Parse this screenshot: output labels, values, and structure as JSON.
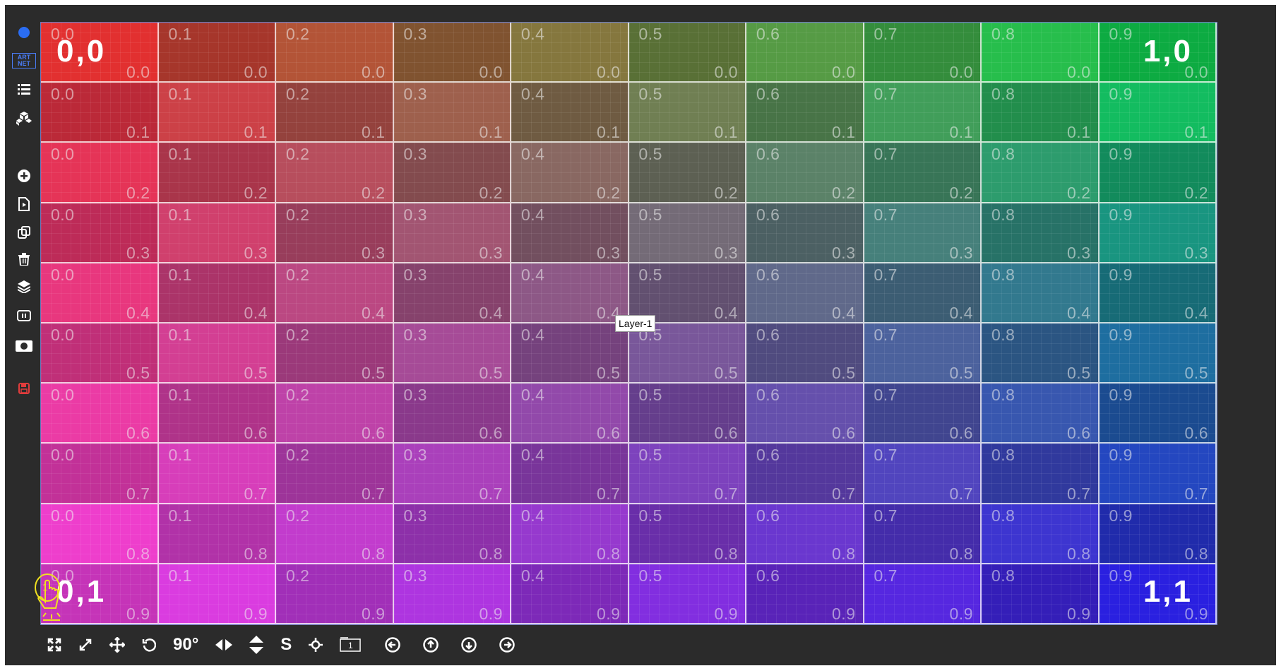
{
  "sidebar": {
    "items": [
      {
        "name": "status-dot-icon",
        "color": "#2a6df4"
      },
      {
        "name": "artnet-icon",
        "label": "ART NET"
      },
      {
        "name": "list-icon"
      },
      {
        "name": "cubes-icon"
      },
      {
        "name": "add-icon"
      },
      {
        "name": "file-play-icon"
      },
      {
        "name": "copy-icon"
      },
      {
        "name": "trash-icon"
      },
      {
        "name": "layers-icon"
      },
      {
        "name": "pause-icon"
      },
      {
        "name": "mask-icon"
      },
      {
        "name": "save-icon",
        "color": "#e23c3c"
      }
    ]
  },
  "canvas": {
    "columns": [
      "0.0",
      "0.1",
      "0.2",
      "0.3",
      "0.4",
      "0.5",
      "0.6",
      "0.7",
      "0.8",
      "0.9"
    ],
    "rows": [
      "0.0",
      "0.1",
      "0.2",
      "0.3",
      "0.4",
      "0.5",
      "0.6",
      "0.7",
      "0.8",
      "0.9"
    ],
    "corner_colors": {
      "top_left": "#e23030",
      "top_right": "#10d050",
      "bottom_left": "#f040e0",
      "bottom_right": "#2a20e0"
    },
    "corners": {
      "top_left": "0,0",
      "top_right": "1,0",
      "bottom_left": "0,1",
      "bottom_right": "1,1"
    },
    "layer_label": "Layer-1"
  },
  "cursor": {
    "badge": "1"
  },
  "toolbar": {
    "items": [
      {
        "name": "fullscreen-icon"
      },
      {
        "name": "resize-diagonal-icon"
      },
      {
        "name": "move-icon"
      },
      {
        "name": "rotate-icon"
      },
      {
        "name": "rotate-90-button",
        "label": "90°"
      },
      {
        "name": "flip-horizontal-icon"
      },
      {
        "name": "flip-vertical-icon"
      },
      {
        "name": "s-button",
        "label": "S"
      },
      {
        "name": "center-icon"
      },
      {
        "name": "layer-number-icon",
        "label": "1"
      },
      {
        "name": "arrow-left-circle-icon"
      },
      {
        "name": "arrow-up-circle-icon"
      },
      {
        "name": "arrow-down-circle-icon"
      },
      {
        "name": "arrow-right-circle-icon"
      }
    ]
  }
}
